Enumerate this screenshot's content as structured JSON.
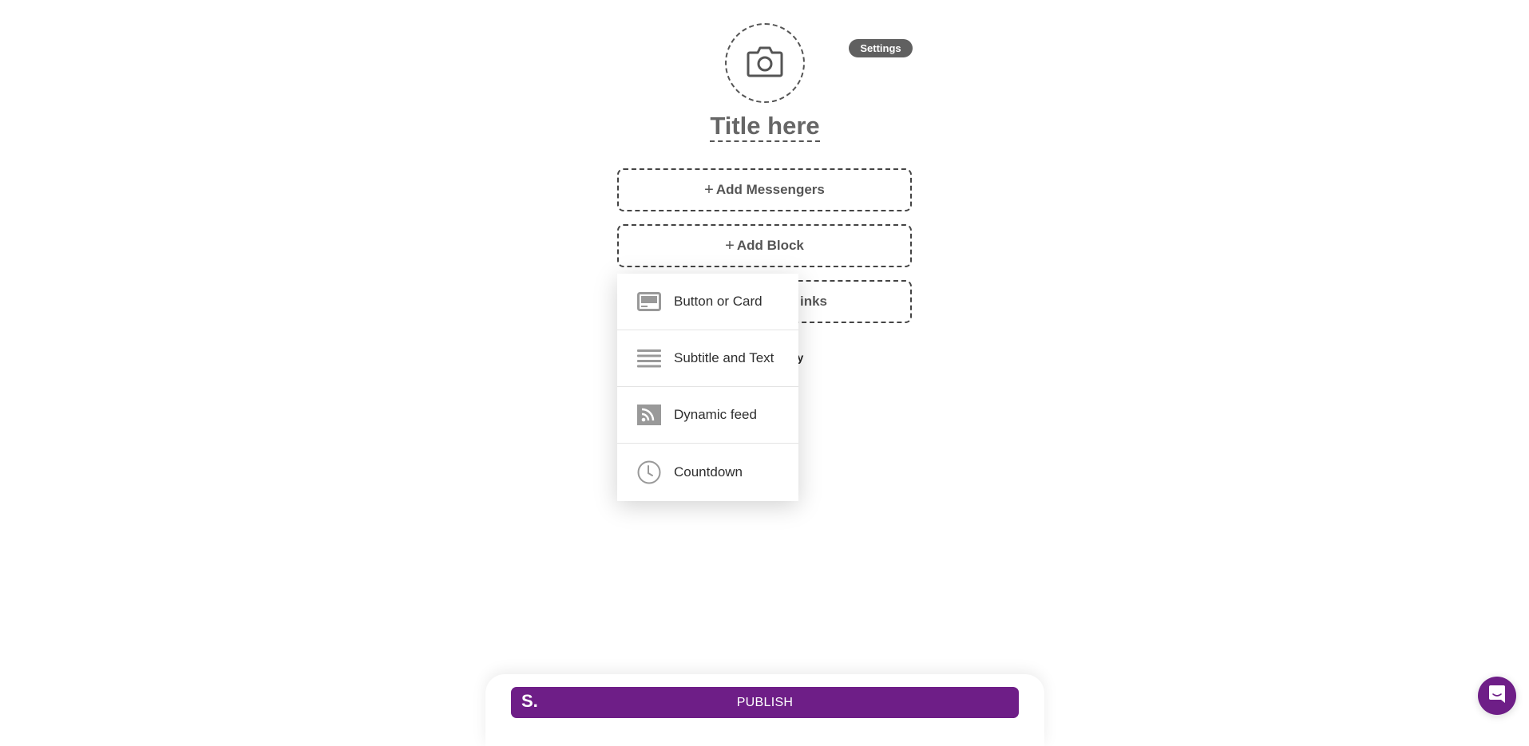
{
  "header": {
    "avatar_icon": "camera-icon",
    "settings_label": "Settings",
    "title_placeholder": "Title here"
  },
  "blocks": {
    "add_messengers_label": "Add Messengers",
    "add_block_label": "Add Block",
    "third_box_visible_label": "inks",
    "behind_menu_text": "py",
    "plus_icon": "plus-icon"
  },
  "add_block_menu": {
    "items": [
      {
        "label": "Button or Card",
        "icon": "card-icon"
      },
      {
        "label": "Subtitle and Text",
        "icon": "text-lines-icon"
      },
      {
        "label": "Dynamic feed",
        "icon": "rss-feed-icon"
      },
      {
        "label": "Countdown",
        "icon": "clock-icon"
      }
    ]
  },
  "footer": {
    "logo_text": "S.",
    "publish_label": "PUBLISH",
    "brand_color": "#6e1e87",
    "chat_icon": "chat-bubble-icon"
  }
}
